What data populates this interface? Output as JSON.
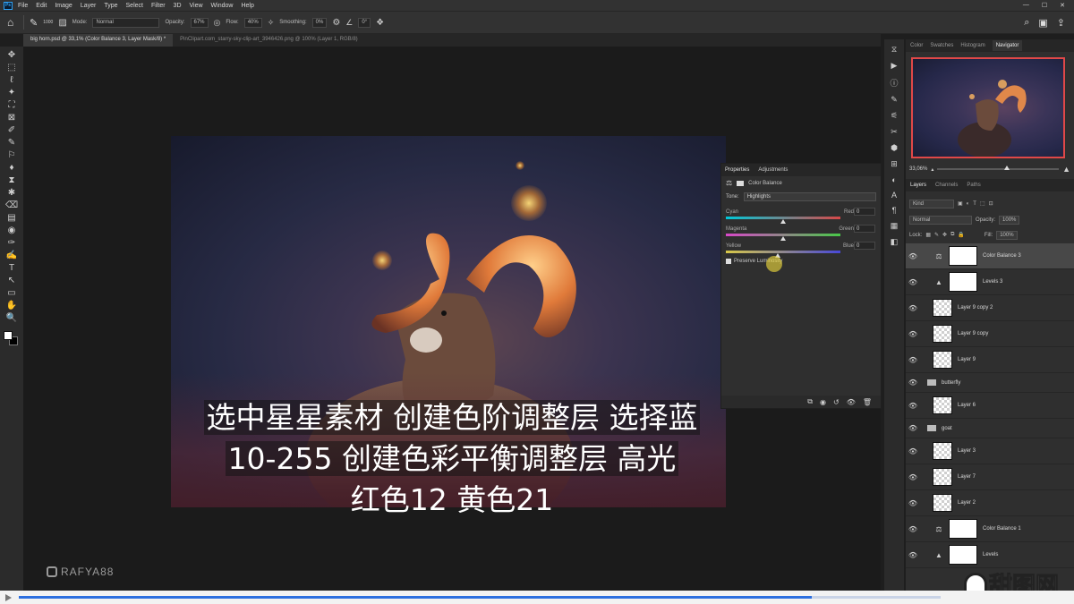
{
  "app": {
    "logo": "Ps"
  },
  "menubar": {
    "items": [
      "File",
      "Edit",
      "Image",
      "Layer",
      "Type",
      "Select",
      "Filter",
      "3D",
      "View",
      "Window",
      "Help"
    ],
    "window_controls": [
      "—",
      "☐",
      "✕"
    ]
  },
  "options": {
    "brush_size": "1000",
    "mode_label": "Mode:",
    "mode_value": "Normal",
    "opacity_label": "Opacity:",
    "opacity_value": "67%",
    "flow_label": "Flow:",
    "flow_value": "40%",
    "smoothing_label": "Smoothing:",
    "smoothing_value": "0%",
    "angle_value": "0°"
  },
  "tabs": [
    {
      "label": "big horn.psd @ 33,1% (Color Balance 3, Layer Mask/8) *"
    },
    {
      "label": "PinClipart.com_starry-sky-clip-art_3946426.png @ 100% (Layer 1, RGB/8)"
    }
  ],
  "tools": [
    "✥",
    "⬚",
    "ℓ",
    "✦",
    "⛶",
    "⊠",
    "✐",
    "✎",
    "⚐",
    "♦",
    "⧗",
    "✱",
    "⌫",
    "▤",
    "◉",
    "✑",
    "✍",
    "T",
    "↖",
    "▭",
    "✋",
    "🔍"
  ],
  "properties": {
    "tabs": [
      "Properties",
      "Adjustments"
    ],
    "title": "Color Balance",
    "tone_label": "Tone:",
    "tone_value": "Highlights",
    "sliders": [
      {
        "left": "Cyan",
        "right": "Red",
        "value": "0",
        "pos": 0.5,
        "gradient": "linear-gradient(90deg,#00c8d8,#d84848)"
      },
      {
        "left": "Magenta",
        "right": "Green",
        "value": "0",
        "pos": 0.5,
        "gradient": "linear-gradient(90deg,#d848c8,#48c848)"
      },
      {
        "left": "Yellow",
        "right": "Blue",
        "value": "0",
        "pos": 0.45,
        "gradient": "linear-gradient(90deg,#d8c848,#4848d8)"
      }
    ],
    "preserve_label": "Preserve Luminosity"
  },
  "navigator": {
    "tabs": [
      "Color",
      "Swatches",
      "Histogram",
      "Navigator"
    ],
    "zoom": "33,06%"
  },
  "layers_panel": {
    "tabs": [
      "Layers",
      "Channels",
      "Paths"
    ],
    "kind": "Kind",
    "blend": "Normal",
    "opacity_label": "Opacity:",
    "opacity_value": "100%",
    "lock_label": "Lock:",
    "fill_label": "Fill:",
    "fill_value": "100%",
    "layers": [
      {
        "name": "Color Balance 3",
        "type": "adj",
        "icon": "⚖",
        "selected": true
      },
      {
        "name": "Levels 3",
        "type": "adj",
        "icon": "▲",
        "selected": false
      },
      {
        "name": "Layer 9 copy 2",
        "type": "pixel",
        "selected": false
      },
      {
        "name": "Layer 9 copy",
        "type": "pixel",
        "selected": false
      },
      {
        "name": "Layer 9",
        "type": "pixel",
        "selected": false
      },
      {
        "name": "butterfly",
        "type": "group",
        "selected": false
      },
      {
        "name": "Layer 6",
        "type": "pixel",
        "selected": false
      },
      {
        "name": "goat",
        "type": "group",
        "selected": false
      },
      {
        "name": "Layer 3",
        "type": "pixel",
        "selected": false
      },
      {
        "name": "Layer 7",
        "type": "pixel",
        "selected": false
      },
      {
        "name": "Layer 2",
        "type": "pixel",
        "selected": false
      },
      {
        "name": "Color Balance 1",
        "type": "adj",
        "icon": "⚖",
        "selected": false
      },
      {
        "name": "Levels",
        "type": "adj",
        "icon": "▲",
        "selected": false
      }
    ]
  },
  "subtitle": {
    "line1": "选中星星素材 创建色阶调整层 选择蓝",
    "line2": "10-255 创建色彩平衡调整层 高光",
    "line3": "红色12 黄色21"
  },
  "watermark": "RAFYA88",
  "video": {
    "progress": 0.86
  },
  "site_logo": "甜图网",
  "colors": {
    "accent": "#2c6fe0",
    "nav_frame": "#e04848"
  }
}
